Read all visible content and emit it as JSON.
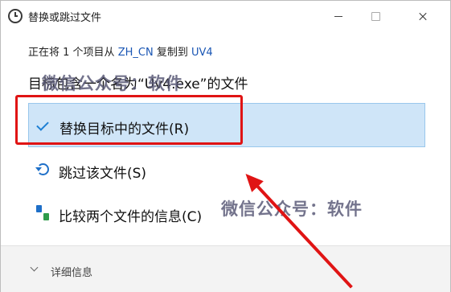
{
  "window": {
    "title": "替换或跳过文件"
  },
  "copy_status": {
    "prefix": "正在将 1 个项目从",
    "source": "ZH_CN",
    "middle": "复制到",
    "destination": "UV4"
  },
  "destination_message": "目标包含一个名为“Uv4.exe”的文件",
  "options": [
    {
      "label": "替换目标中的文件(R)",
      "icon": "check-icon",
      "selected": true
    },
    {
      "label": "跳过该文件(S)",
      "icon": "skip-icon"
    },
    {
      "label": "比较两个文件的信息(C)",
      "icon": "compare-icon"
    }
  ],
  "footer": {
    "details_label": "详细信息"
  },
  "watermark": {
    "text": "微信公众号：软件"
  },
  "colors": {
    "accent": "#1e7fd4",
    "selection": "#cfe5f8",
    "annotation": "#e01414"
  }
}
